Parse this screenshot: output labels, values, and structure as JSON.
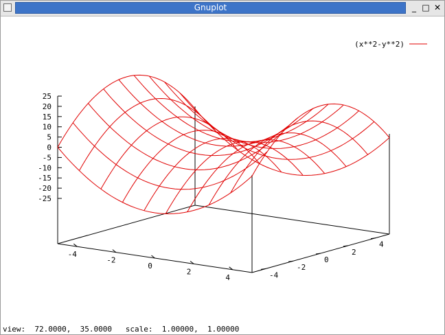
{
  "window": {
    "title": "Gnuplot",
    "controls": {
      "minimize": "_",
      "maximize": "□",
      "close": "✕"
    }
  },
  "status_bar": {
    "text": "view:  72.0000,  35.0000   scale:  1.00000,  1.00000"
  },
  "chart_data": {
    "type": "surface-3d",
    "function": "x**2-y**2",
    "legend": [
      "(x**2-y**2)"
    ],
    "legend_position": "top-right",
    "colors": {
      "surface": "#e00000",
      "axes": "#000000"
    },
    "x_range": [
      -5,
      5
    ],
    "y_range": [
      -5,
      5
    ],
    "z_range": [
      -25,
      25
    ],
    "x_ticks": [
      "-4",
      "-2",
      "0",
      "2",
      "4"
    ],
    "y_ticks": [
      "-4",
      "-2",
      "0",
      "2",
      "4"
    ],
    "z_ticks": [
      "25",
      "20",
      "15",
      "10",
      "5",
      "0",
      "-5",
      "-10",
      "-15",
      "-20",
      "-25"
    ],
    "view": [
      72,
      35
    ],
    "isosamples": 10,
    "grid": false
  }
}
